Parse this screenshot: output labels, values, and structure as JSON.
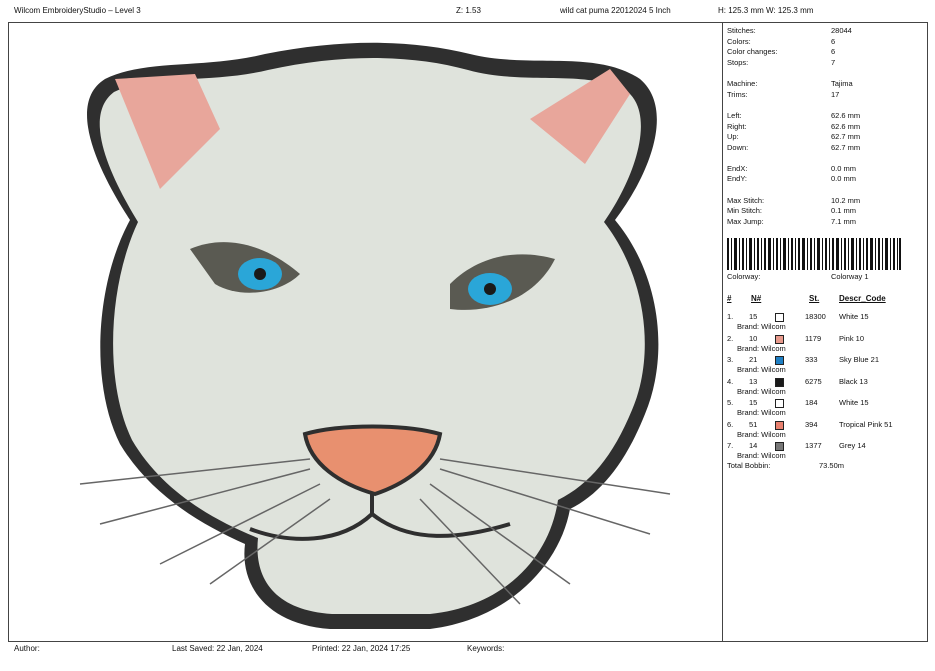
{
  "header": {
    "app_title": "Wilcom EmbroideryStudio – Level 3",
    "zoom": "Z: 1.53",
    "design_name": "wild cat puma 22012024 5 Inch",
    "height": "H: 125.3 mm",
    "width": "W: 125.3 mm"
  },
  "stats": [
    {
      "label": "Stitches:",
      "value": "28044"
    },
    {
      "label": "Colors:",
      "value": "6"
    },
    {
      "label": "Color changes:",
      "value": "6"
    },
    {
      "label": "Stops:",
      "value": "7"
    },
    {
      "label": "Machine:",
      "value": "Tajima"
    },
    {
      "label": "Trims:",
      "value": "17"
    },
    {
      "label": "Left:",
      "value": "62.6 mm"
    },
    {
      "label": "Right:",
      "value": "62.6 mm"
    },
    {
      "label": "Up:",
      "value": "62.7 mm"
    },
    {
      "label": "Down:",
      "value": "62.7 mm"
    },
    {
      "label": "EndX:",
      "value": "0.0 mm"
    },
    {
      "label": "EndY:",
      "value": "0.0 mm"
    },
    {
      "label": "Max Stitch:",
      "value": "10.2 mm"
    },
    {
      "label": "Min Stitch:",
      "value": "0.1 mm"
    },
    {
      "label": "Max Jump:",
      "value": "7.1 mm"
    }
  ],
  "colorway": {
    "label": "Colorway:",
    "value": "Colorway 1"
  },
  "color_table": {
    "headers": {
      "hash": "#",
      "n": "N#",
      "st": "St.",
      "descr": "Descr_Code"
    },
    "rows": [
      {
        "idx": "1.",
        "n": "15",
        "color": "#ffffff",
        "st": "18300",
        "descr": "White 15",
        "brand": "Brand: Wilcom"
      },
      {
        "idx": "2.",
        "n": "10",
        "color": "#e89a8c",
        "st": "1179",
        "descr": "Pink 10",
        "brand": "Brand: Wilcom"
      },
      {
        "idx": "3.",
        "n": "21",
        "color": "#1e7fc4",
        "st": "333",
        "descr": "Sky Blue 21",
        "brand": "Brand: Wilcom"
      },
      {
        "idx": "4.",
        "n": "13",
        "color": "#1a1a1a",
        "st": "6275",
        "descr": "Black 13",
        "brand": "Brand: Wilcom"
      },
      {
        "idx": "5.",
        "n": "15",
        "color": "#ffffff",
        "st": "184",
        "descr": "White 15",
        "brand": "Brand: Wilcom"
      },
      {
        "idx": "6.",
        "n": "51",
        "color": "#e8806e",
        "st": "394",
        "descr": "Tropical Pink 51",
        "brand": "Brand: Wilcom"
      },
      {
        "idx": "7.",
        "n": "14",
        "color": "#777777",
        "st": "1377",
        "descr": "Grey 14",
        "brand": "Brand: Wilcom"
      }
    ]
  },
  "total_bobbin": {
    "label": "Total Bobbin:",
    "value": "73.50m"
  },
  "footer": {
    "author": "Author:",
    "last_saved": "Last Saved: 22 Jan, 2024",
    "printed": "Printed: 22 Jan, 2024 17:25",
    "keywords": "Keywords:"
  },
  "colors": {
    "face": "#dfe3dc",
    "outline": "#2f2f2f",
    "eye": "#2aa6d8",
    "nose": "#e8906f",
    "ear": "#e8a69b"
  }
}
